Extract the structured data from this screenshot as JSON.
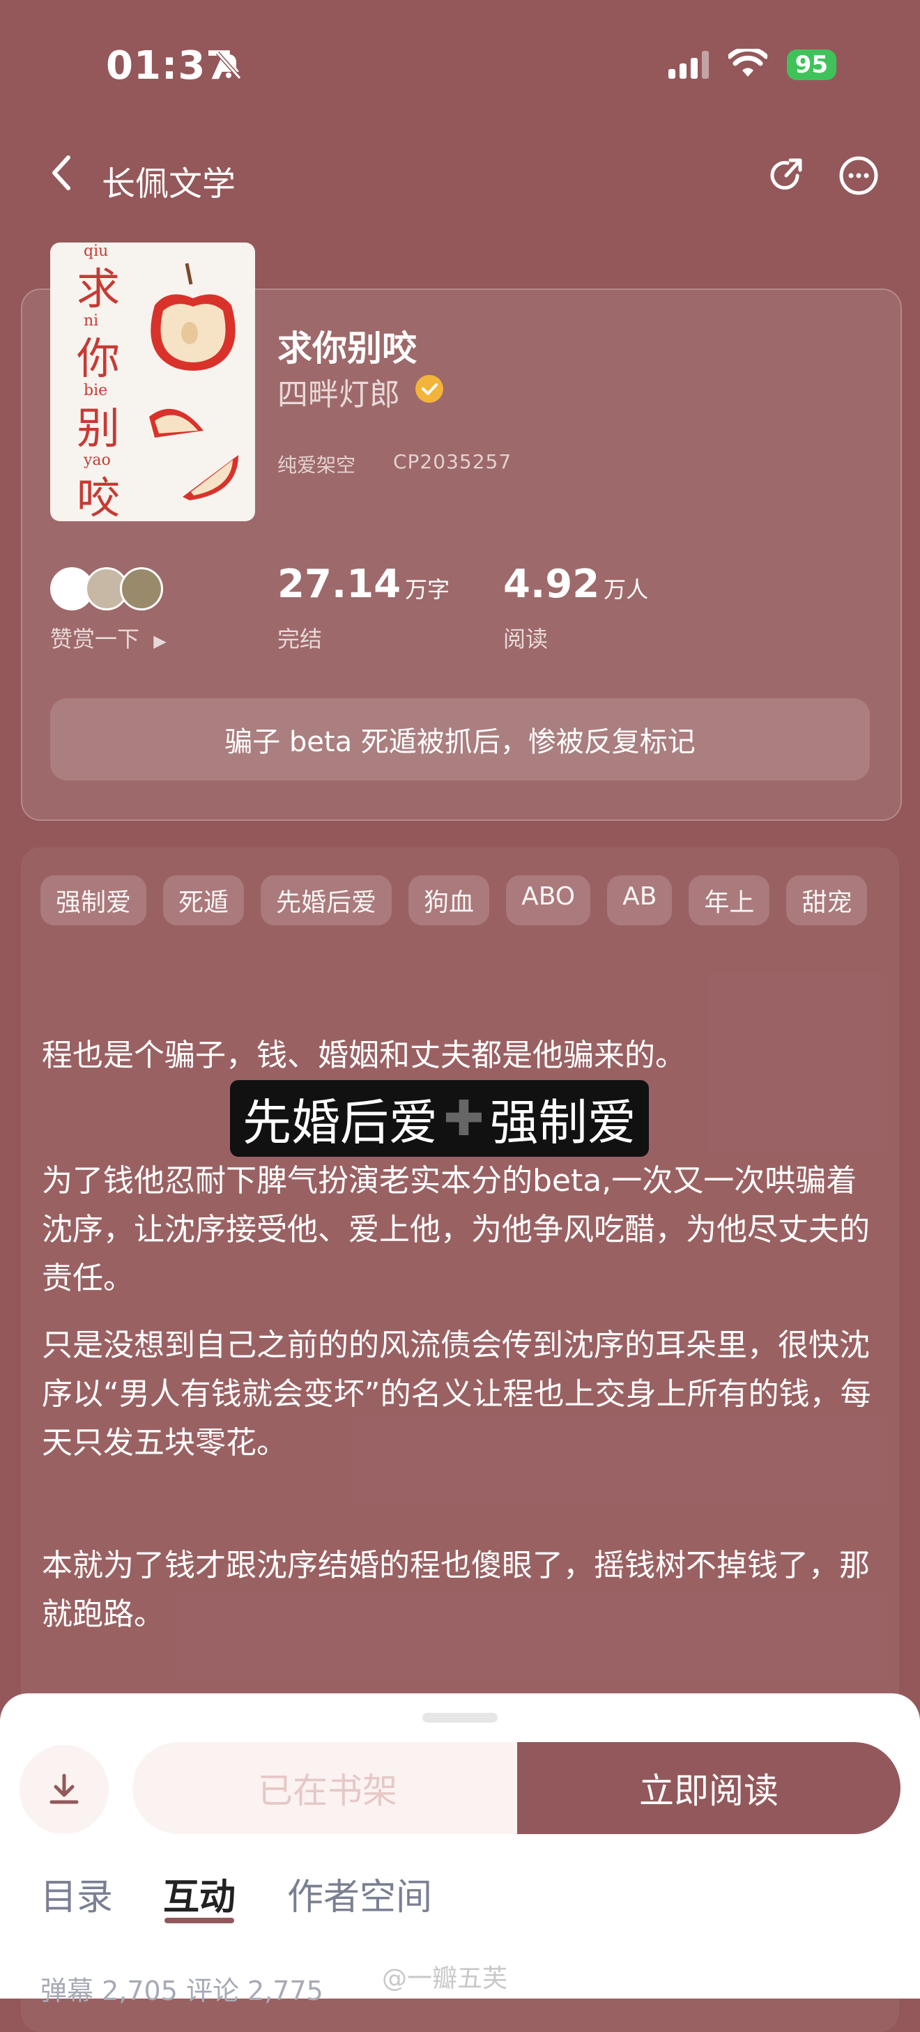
{
  "status": {
    "time": "01:37",
    "battery": "95"
  },
  "nav": {
    "title": "长佩文学"
  },
  "book": {
    "cover_chars": [
      "求",
      "你",
      "别",
      "咬"
    ],
    "cover_pinyin": [
      "qiu",
      "ni",
      "bie",
      "yao"
    ],
    "title": "求你别咬",
    "author": "四畔灯郎",
    "category": "纯爱架空",
    "id": "CP2035257",
    "reward_label": "赞赏一下",
    "stats": [
      {
        "value": "27.14",
        "unit": "万字",
        "label": "完结"
      },
      {
        "value": "4.92",
        "unit": "万人",
        "label": "阅读"
      }
    ],
    "intro": "骗子 beta 死遁被抓后，惨被反复标记"
  },
  "tags": [
    "强制爱",
    "死遁",
    "先婚后爱",
    "狗血",
    "ABO",
    "AB",
    "年上",
    "甜宠"
  ],
  "description": {
    "p1": "程也是个骗子，钱、婚姻和丈夫都是他骗来的。",
    "highlight_left": "先婚后爱",
    "highlight_right": "强制爱",
    "p2": "为了钱他忍耐下脾气扮演老实本分的beta,一次又一次哄骗着沈序，让沈序接受他、爱上他，为他争风吃醋，为他尽丈夫的责任。",
    "p3": "只是没想到自己之前的的风流债会传到沈序的耳朵里，很快沈序以“男人有钱就会变坏”的名义让程也上交身上所有的钱，每天只发五块零花。",
    "p4": "本就为了钱才跟沈序结婚的程也傻眼了，摇钱树不掉钱了，那就跑路。"
  },
  "actions": {
    "shelf": "已在书架",
    "read": "立即阅读"
  },
  "tabs": [
    "目录",
    "互动",
    "作者空间"
  ],
  "counts": "弹幕 2,705  评论 2,775",
  "watermark": "@一瓣五芙",
  "colors": {
    "background": "#94585a",
    "accent": "#93585b"
  }
}
